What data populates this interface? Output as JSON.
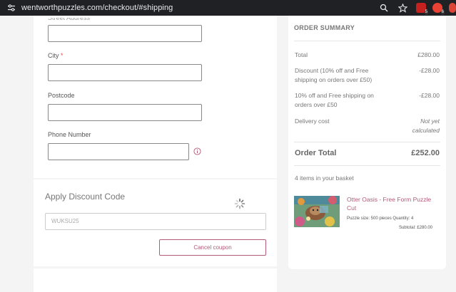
{
  "browser": {
    "url": "wentworthpuzzles.com/checkout/#shipping",
    "extensions": [
      {
        "name": "gmail-extension-icon",
        "color": "#c5221f",
        "badge": "5"
      },
      {
        "name": "google-extension-icon",
        "color": "#e94235",
        "badge": "6"
      },
      {
        "name": "chrome-extension-icon",
        "color": "#db4437",
        "badge": ""
      }
    ]
  },
  "form": {
    "cut_label": "Street Address",
    "city_label": "City",
    "required_mark": "*",
    "postcode_label": "Postcode",
    "phone_label": "Phone Number"
  },
  "discount": {
    "title": "Apply Discount Code",
    "code_value": "WUKSU25",
    "cancel_label": "Cancel coupon"
  },
  "summary": {
    "heading": "ORDER SUMMARY",
    "rows": [
      {
        "label": "Total",
        "value": "£280.00"
      },
      {
        "label": "Discount (10% off and Free shipping on orders over £50)",
        "value": "-£28.00"
      },
      {
        "label": "10% off and Free shipping on orders over £50",
        "value": "-£28.00"
      },
      {
        "label": "Delivery cost",
        "value": "Not yet calculated"
      }
    ],
    "order_total_label": "Order Total",
    "order_total_value": "£252.00",
    "items_count": "4 items in your basket",
    "product": {
      "name": "Otter Oasis - Free Form Puzzle Cut",
      "meta": "Puzzle size: 500 pieces Quantity: 4",
      "subtotal": "Subtotal: £280.00"
    }
  },
  "colors": {
    "accent": "#b35a78",
    "browser_bar": "#202124",
    "page_bg": "#f4f4f4"
  }
}
